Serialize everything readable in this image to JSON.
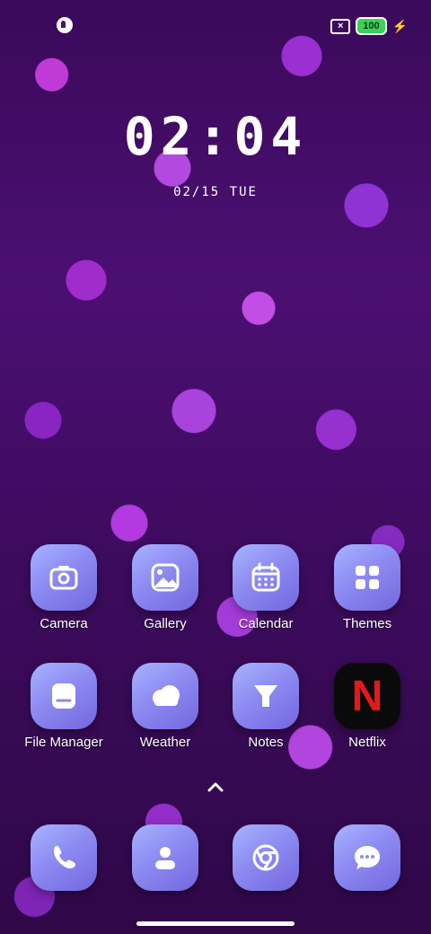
{
  "status_bar": {
    "left_icon": "notification-app-icon",
    "sim_icon": "no-sim-icon",
    "battery_level": "100",
    "charging_icon": "bolt-icon"
  },
  "clock": {
    "time": "02:04",
    "date": "02/15 TUE"
  },
  "apps": [
    {
      "label": "Camera",
      "icon": "camera-icon"
    },
    {
      "label": "Gallery",
      "icon": "gallery-icon"
    },
    {
      "label": "Calendar",
      "icon": "calendar-icon"
    },
    {
      "label": "Themes",
      "icon": "themes-icon"
    },
    {
      "label": "File Manager",
      "icon": "file-manager-icon"
    },
    {
      "label": "Weather",
      "icon": "weather-icon"
    },
    {
      "label": "Notes",
      "icon": "notes-icon"
    },
    {
      "label": "Netflix",
      "icon": "netflix-icon",
      "glyph": "N"
    }
  ],
  "dock": [
    {
      "icon": "phone-icon"
    },
    {
      "icon": "contacts-icon"
    },
    {
      "icon": "browser-icon"
    },
    {
      "icon": "messages-icon"
    }
  ],
  "colors": {
    "tile_gradient_start": "#a7b4ff",
    "tile_gradient_end": "#7367df",
    "netflix_red": "#e11a1a",
    "battery_green": "#3dd05a"
  }
}
